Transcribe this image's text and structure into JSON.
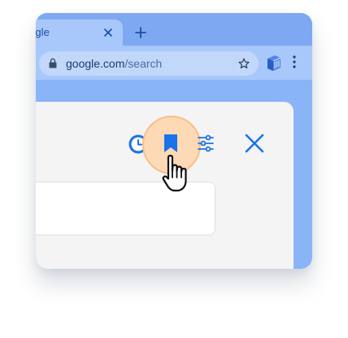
{
  "tab": {
    "title": "ogle"
  },
  "omnibox": {
    "host": "google.com",
    "path": "/search"
  },
  "icons": {
    "tab_close": "close-icon",
    "new_tab": "plus-icon",
    "lock": "lock-icon",
    "star": "star-icon",
    "extension": "extension-icon",
    "menu": "more-vert-icon",
    "history": "history-icon",
    "bookmark": "bookmark-icon",
    "filters": "filter-icon",
    "close_panel": "close-icon",
    "pointer": "hand-pointer-icon"
  },
  "colors": {
    "accent": "#1a73e8",
    "highlight": "#fdd9b6",
    "chrome_frame": "#8ab4f8"
  }
}
